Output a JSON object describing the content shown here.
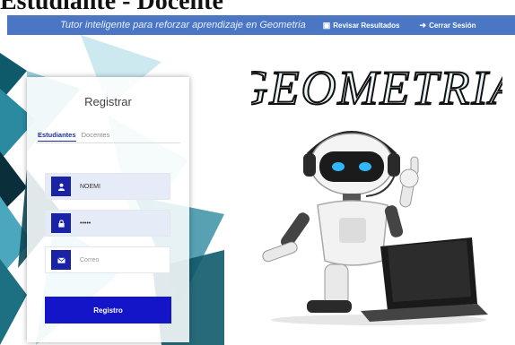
{
  "page": {
    "heading": "Estudiante - Docente"
  },
  "topbar": {
    "tagline": "Tutor inteligente para reforzar aprendizaje en Geometria",
    "results_label": "Revisar Resultados",
    "logout_label": "Cerrar Sesión"
  },
  "register": {
    "title": "Registrar",
    "tabs": [
      {
        "label": "Estudiantes"
      },
      {
        "label": "Docentes"
      }
    ],
    "username_value": "NOEMI",
    "password_value": "•••••",
    "email_placeholder": "Correo",
    "submit_label": "Registro"
  },
  "hero": {
    "logo_text": "GEOMETRIA"
  },
  "colors": {
    "topbar": "#4b76c4",
    "primary": "#1414c8",
    "icon_bg": "#1a22a6"
  },
  "icons": [
    "book-icon",
    "sign-out-icon",
    "user-icon",
    "lock-icon",
    "envelope-icon"
  ]
}
